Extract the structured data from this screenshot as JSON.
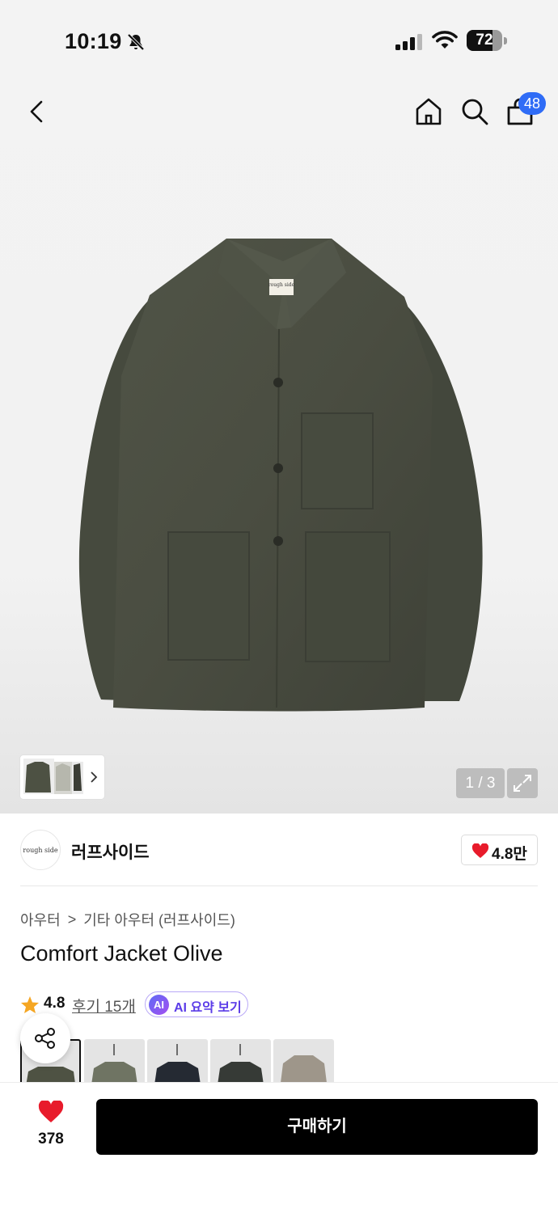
{
  "status_bar": {
    "time": "10:19",
    "battery": "72",
    "battery_level": 0.72
  },
  "header": {
    "cart_count": "48"
  },
  "gallery": {
    "pager": "1 / 3",
    "image_label": "rough side"
  },
  "brand": {
    "logo_text": "rough side",
    "name": "러프사이드",
    "likes": "4.8만"
  },
  "breadcrumb": {
    "category": "아우터",
    "separator": ">",
    "subcategory": "기타 아우터 (러프사이드)"
  },
  "product": {
    "title": "Comfort Jacket Olive",
    "rating": "4.8",
    "reviews": "후기 15개",
    "ai_badge": "AI",
    "ai_summary": "AI 요약 보기"
  },
  "color_options": [
    "olive",
    "khaki",
    "navy",
    "charcoal",
    "beige"
  ],
  "bottom_bar": {
    "wish_count": "378",
    "buy_label": "구매하기"
  },
  "colors": {
    "accent_blue": "#2f6cf6",
    "heart_red": "#e81b2b",
    "star": "#f5a623",
    "ai_purple": "#5b3ce8"
  }
}
